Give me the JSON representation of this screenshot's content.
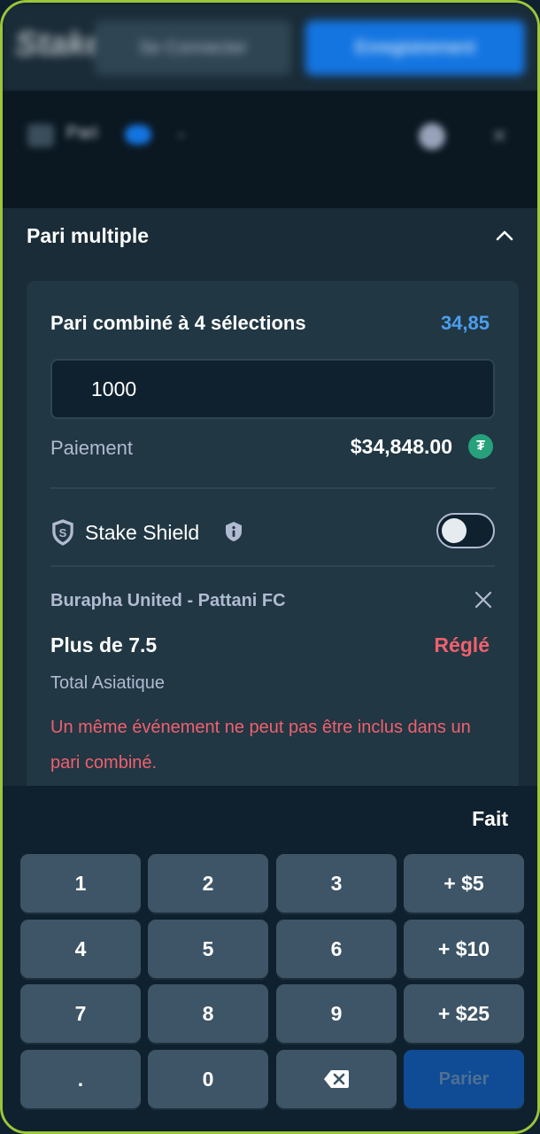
{
  "header": {
    "logo_text": "Stake",
    "login_label": "Se Connecter",
    "register_label": "Enregistrement"
  },
  "subheader": {
    "label": "Pari",
    "badge": "1"
  },
  "betslip": {
    "section_title": "Pari multiple",
    "combo_title": "Pari combiné à 4 sélections",
    "odds": "34,85",
    "stake_value": "1000",
    "payout_label": "Paiement",
    "payout_value": "$34,848.00",
    "currency_icon": "tether-icon",
    "shield_label": "Stake Shield",
    "shield_enabled": false,
    "selection": {
      "match": "Burapha United - Pattani FC",
      "outcome": "Plus de 7.5",
      "status": "Réglé",
      "market": "Total Asiatique",
      "error": "Un même événement ne peut pas être inclus dans un pari combiné."
    }
  },
  "keypad": {
    "done_label": "Fait",
    "keys": [
      "1",
      "2",
      "3",
      "+ $5",
      "4",
      "5",
      "6",
      "+ $10",
      "7",
      "8",
      "9",
      "+ $25",
      ".",
      "0",
      "",
      "Parier"
    ]
  },
  "colors": {
    "accent_blue": "#1475e1",
    "odds_blue": "#4c9eee",
    "error_red": "#f0606e",
    "panel_bg": "#1a2c38"
  }
}
